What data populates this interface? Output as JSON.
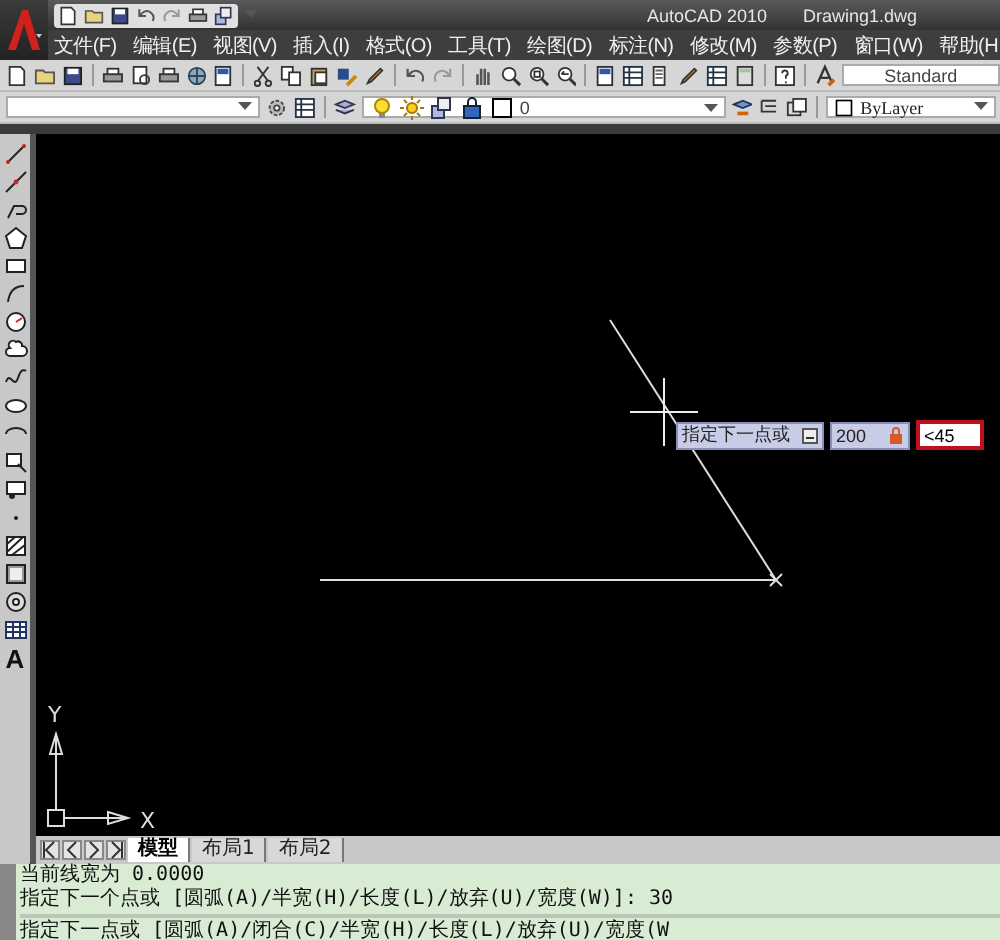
{
  "title_bar": {
    "app": "AutoCAD 2010",
    "file": "Drawing1.dwg"
  },
  "menu_bar": {
    "items": [
      "文件(F)",
      "编辑(E)",
      "视图(V)",
      "插入(I)",
      "格式(O)",
      "工具(T)",
      "绘图(D)",
      "标注(N)",
      "修改(M)",
      "参数(P)",
      "窗口(W)",
      "帮助(H"
    ]
  },
  "standard_toolbar": {
    "text_style": "Standard"
  },
  "layers_toolbar": {
    "layer": "0",
    "color_control": "ByLayer"
  },
  "draw_toolbar": {
    "text_glyph": "A"
  },
  "canvas": {
    "dynamic_input": {
      "prompt": "指定下一点或",
      "length": "200",
      "angle": "<45"
    },
    "ucs": {
      "y_label": "Y",
      "x_label": "X"
    }
  },
  "layout_tabs": [
    {
      "label": "模型",
      "selected": true
    },
    {
      "label": "布局1",
      "selected": false
    },
    {
      "label": "布局2",
      "selected": false
    }
  ],
  "command_history": [
    "当前线宽为 0.0000",
    "指定下一个点或 [圆弧(A)/半宽(H)/长度(L)/放弃(U)/宽度(W)]: 30"
  ],
  "command_line": "指定下一点或 [圆弧(A)/闭合(C)/半宽(H)/长度(L)/放弃(U)/宽度(W"
}
